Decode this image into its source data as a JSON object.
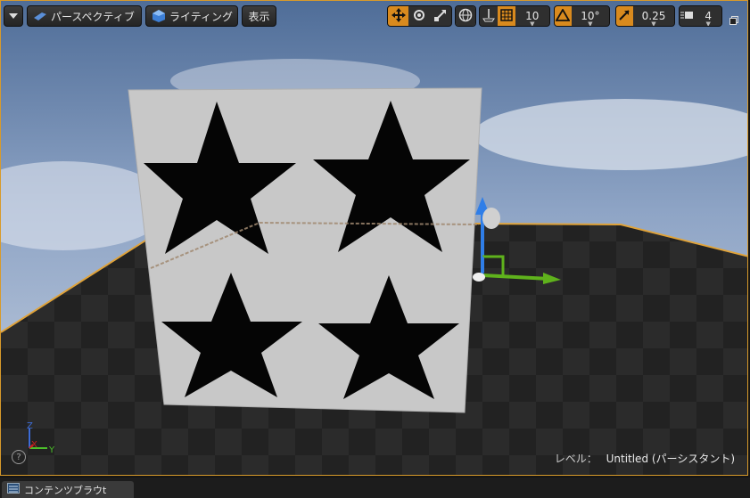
{
  "toolbar": {
    "menu_icon": "chevron-down-icon",
    "perspective_label": "パースペクティブ",
    "lighting_label": "ライティング",
    "show_label": "表示",
    "grid_snap_value": "10",
    "rotation_snap_value": "10°",
    "scale_snap_value": "0.25",
    "camera_speed_value": "4"
  },
  "viewport": {
    "level_label": "レベル：",
    "level_name": "Untitled (パーシスタント)",
    "axis_z": "Z",
    "axis_x": "X",
    "axis_y": "Y",
    "help_glyph": "?"
  },
  "bottom": {
    "content_browser_label": "コンテンツブラウt"
  },
  "colors": {
    "accent": "#d98a1e",
    "selection_border": "#d89a2a",
    "gizmo_x": "#c81e1e",
    "gizmo_y": "#5fb21c",
    "gizmo_z": "#2f7ee8"
  }
}
